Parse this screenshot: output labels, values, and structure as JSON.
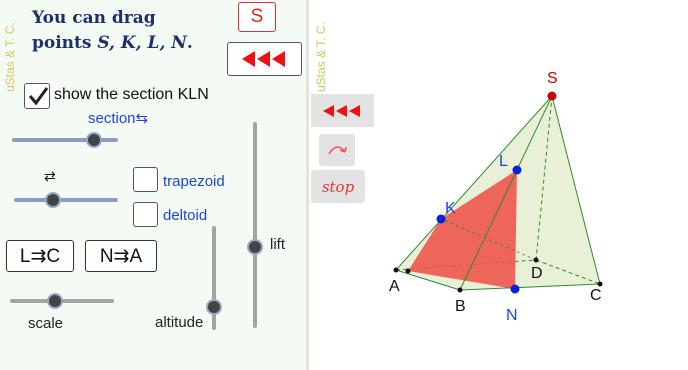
{
  "credit": "uStas & T. C.",
  "instruction": {
    "line1": "You can drag",
    "line2_prefix": "points ",
    "line2_points": "S, K, L, N",
    "line2_suffix": "."
  },
  "buttons": {
    "s_label": "S",
    "rewind_icon": "rewind-triple-triangle-icon",
    "rotate_icon": "rotate-arc-icon",
    "stop_label": "stop",
    "l_to_c": "L⇉C",
    "n_to_a": "N⇉A"
  },
  "checkboxes": {
    "show_section": {
      "label": "show the section KLN",
      "checked": true
    },
    "trapezoid": {
      "label": "trapezoid",
      "checked": false
    },
    "deltoid": {
      "label": "deltoid",
      "checked": false
    }
  },
  "sliders": {
    "section": {
      "label": "section⇆",
      "value_fraction": 0.78
    },
    "swap": {
      "label": "⇄",
      "value_fraction": 0.38
    },
    "scale": {
      "label": "scale",
      "value_fraction": 0.45
    },
    "altitude": {
      "label": "altitude",
      "value_fraction": 0.1
    },
    "lift": {
      "label": "lift",
      "value_fraction": 0.6
    }
  },
  "points": {
    "S": "S",
    "K": "K",
    "L": "L",
    "N": "N",
    "A": "A",
    "B": "B",
    "C": "C",
    "D": "D"
  },
  "colors": {
    "section_fill": "#ee5a4e",
    "pyramid_face": "#e9f0d8",
    "edge": "#2e8b2e",
    "apex_point": "#cc0000",
    "draggable_point": "#0b1ed8",
    "label_blue": "#1d43e6"
  }
}
